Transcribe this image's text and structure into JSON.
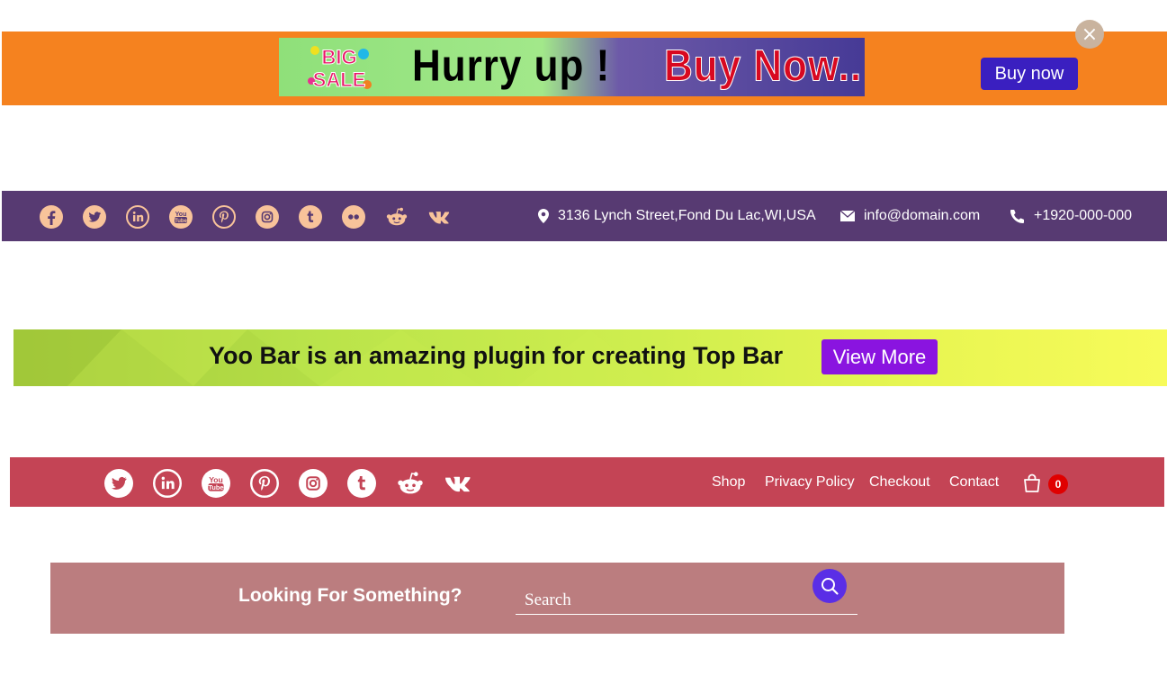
{
  "colors": {
    "c1": "#f5821f",
    "btn1": "#3a1fc0",
    "c2": "#573a72",
    "btn3": "#8a14e0",
    "c4": "#c44455",
    "badge": "#e00000",
    "c5": "#bb7d7f",
    "btn5": "#5a2ee6",
    "icon_peach": "#f8c39a"
  },
  "sale_bar": {
    "badge_line1": "BIG",
    "badge_line2": "SALE",
    "headline": "Hurry up !",
    "headline_accent": "Buy Now..",
    "button_label": "Buy now",
    "close_symbol": "×"
  },
  "contact_bar": {
    "social_icons": [
      "facebook-icon",
      "twitter-icon",
      "linkedin-icon",
      "youtube-icon",
      "pinterest-icon",
      "instagram-icon",
      "tumblr-icon",
      "flickr-icon",
      "reddit-icon",
      "vk-icon"
    ],
    "address": "3136 Lynch Street,Fond Du Lac,WI,USA",
    "email": "info@domain.com",
    "phone": "+1920-000-000"
  },
  "promo_bar": {
    "message": "Yoo Bar is an amazing plugin for creating Top Bar",
    "button_label": "View More"
  },
  "nav_bar": {
    "social_icons": [
      "twitter-icon",
      "linkedin-icon",
      "youtube-icon",
      "pinterest-icon",
      "instagram-icon",
      "tumblr-icon",
      "reddit-icon",
      "vk-icon"
    ],
    "links": [
      "Shop",
      "Privacy Policy",
      "Checkout",
      "Contact"
    ],
    "cart_count": "0"
  },
  "search_bar": {
    "heading": "Looking For Something?",
    "placeholder": "Search"
  }
}
